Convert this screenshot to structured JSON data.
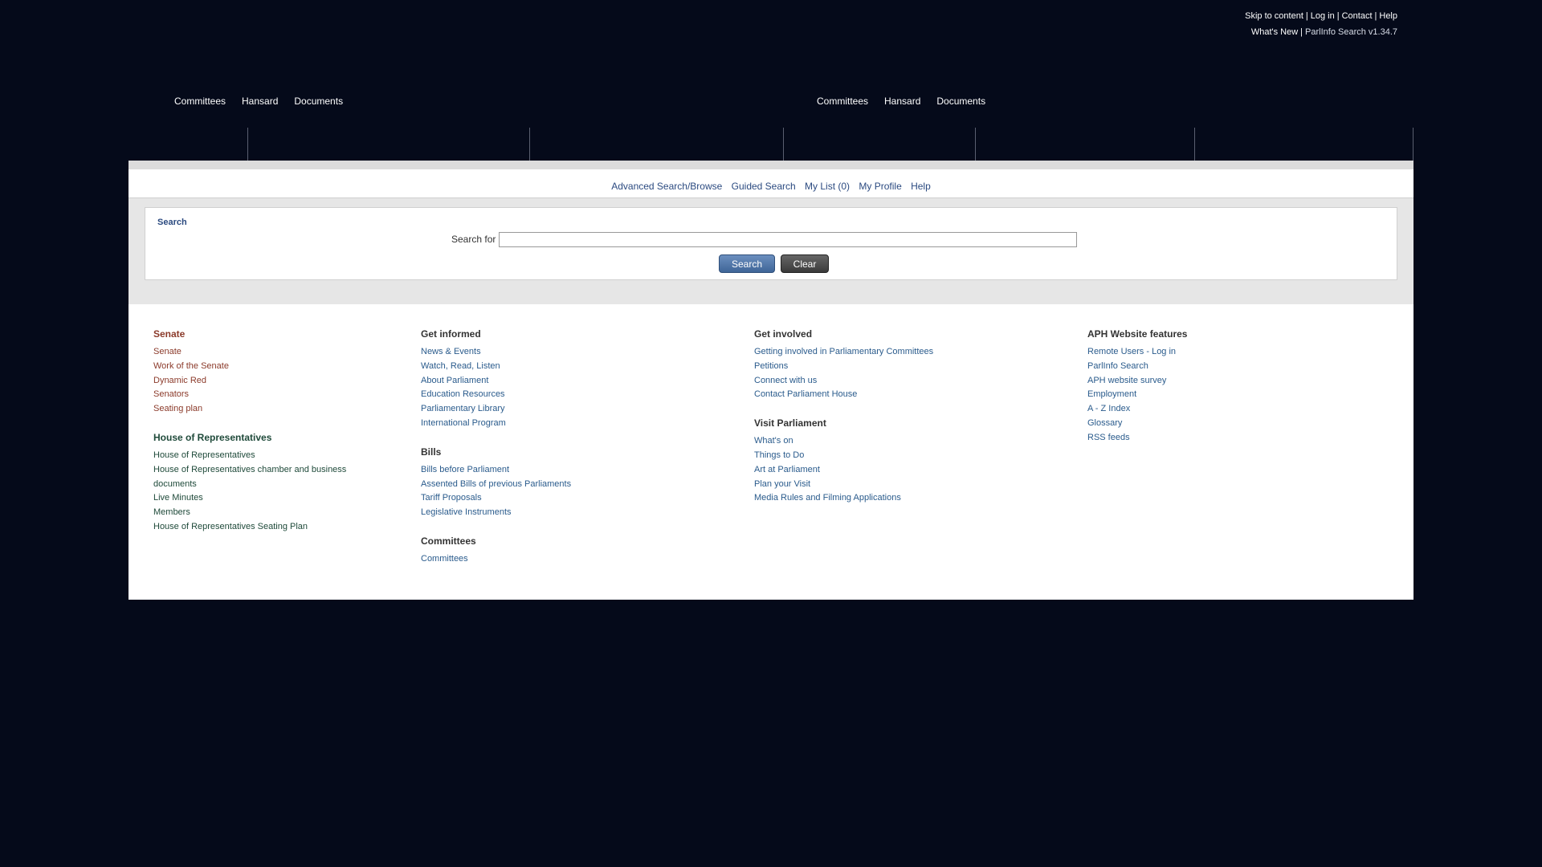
{
  "top_links": {
    "skip": "Skip to content",
    "login": "Log in",
    "contact": "Contact",
    "help": "Help",
    "sep": "|",
    "whats_new": "What's New",
    "version": "ParlInfo Search v1.34.7"
  },
  "main_nav_left": [
    "Committees",
    "Hansard",
    "Documents"
  ],
  "main_nav_right": [
    "Committees",
    "Hansard",
    "Documents"
  ],
  "toolbar": {
    "advanced": "Advanced Search/Browse",
    "guided": "Guided Search",
    "mylist": "My List (0)",
    "profile": "My Profile",
    "help": "Help"
  },
  "search": {
    "title": "Search",
    "label": "Search for",
    "value": "",
    "search_button": "Search",
    "clear_button": "Clear"
  },
  "footer": {
    "senate": {
      "heading": "Senate",
      "links": [
        "Senate",
        "Work of the Senate",
        "Dynamic Red",
        "Senators",
        "Seating plan"
      ]
    },
    "house": {
      "heading": "House of Representatives",
      "links": [
        "House of Representatives",
        "House of Representatives chamber and business documents",
        "Live Minutes",
        "Members",
        "House of Representatives Seating Plan"
      ]
    },
    "get_informed": {
      "heading": "Get informed",
      "links": [
        "News & Events",
        "Watch, Read, Listen",
        "About Parliament",
        "Education Resources",
        "Parliamentary Library",
        "International Program"
      ]
    },
    "bills": {
      "heading": "Bills",
      "links": [
        "Bills before Parliament",
        "Assented Bills of previous Parliaments",
        "Tariff Proposals",
        "Legislative Instruments"
      ]
    },
    "committees": {
      "heading": "Committees",
      "links": [
        "Committees"
      ]
    },
    "get_involved": {
      "heading": "Get involved",
      "links": [
        "Getting involved in Parliamentary Committees",
        "Petitions",
        "Connect with us",
        "Contact Parliament House"
      ]
    },
    "visit": {
      "heading": "Visit Parliament",
      "links": [
        "What's on",
        "Things to Do",
        "Art at Parliament",
        "Plan your Visit",
        "Media Rules and Filming Applications"
      ]
    },
    "aph": {
      "heading": "APH Website features",
      "links": [
        "Remote Users - Log in",
        "ParlInfo Search",
        "APH website survey",
        "Employment",
        "A - Z Index",
        "Glossary",
        "RSS feeds"
      ]
    }
  }
}
